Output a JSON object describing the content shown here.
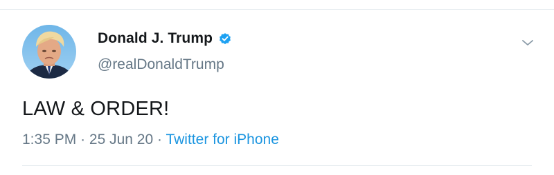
{
  "tweet": {
    "author": {
      "display_name": "Donald J. Trump",
      "handle": "@realDonaldTrump",
      "verified": true,
      "avatar_icon": "profile-photo"
    },
    "text": "LAW & ORDER!",
    "time": "1:35 PM",
    "separator": "·",
    "date": "25 Jun 20",
    "source": "Twitter for iPhone",
    "menu_icon": "chevron-down-icon"
  },
  "colors": {
    "primary_text": "#14171a",
    "secondary_text": "#657786",
    "link": "#1b95e0",
    "verified_badge": "#1da1f2",
    "divider": "#e1e8ed"
  }
}
